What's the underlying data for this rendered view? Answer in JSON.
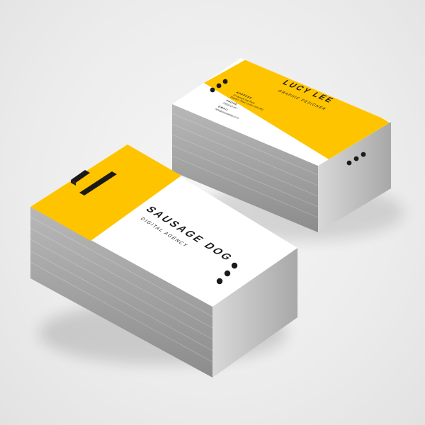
{
  "colors": {
    "background": "#ececec",
    "yellow": "#FFC400",
    "card_white": "#ffffff",
    "ink": "#1a1a1a",
    "stack_edge": "#9a9a9a"
  },
  "back_card": {
    "name": "LUCY LEE",
    "role": "GRAPHIC DESIGNER",
    "address_label": "ADDRESS",
    "address_lines": [
      "37 Sausage Dog Road",
      "Dogtown, Road, London W2N 2PQ"
    ],
    "phone_label": "PHONE",
    "phone_value": "07958 123 457",
    "email_label": "EMAIL",
    "email_value": "hello@sausagedog.co.uk"
  },
  "front_card": {
    "brand": "SAUSAGE DOG",
    "tagline": "DIGITAL AGENCY"
  },
  "icons": {
    "stripes": "double-bar-icon",
    "dots": "three-dots-icon"
  }
}
